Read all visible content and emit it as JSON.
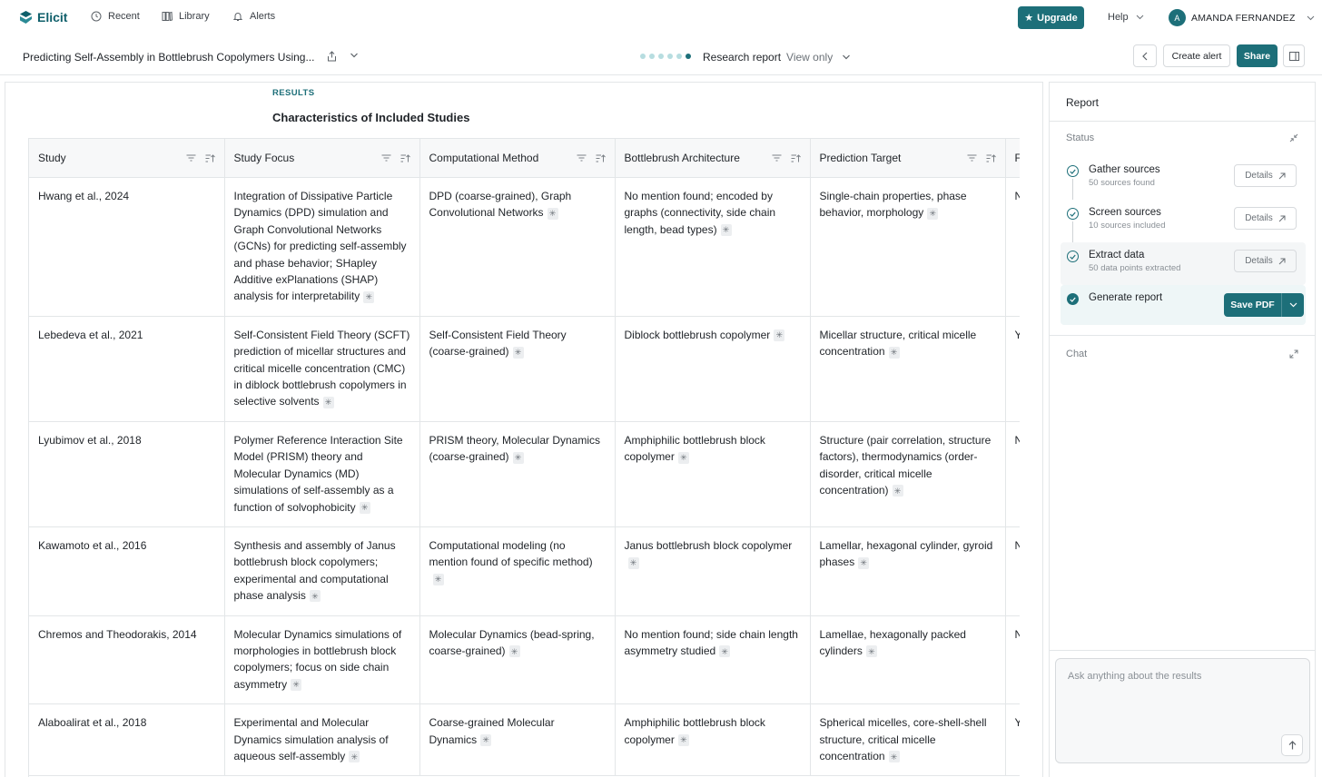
{
  "nav": {
    "brand": "Elicit",
    "recent": "Recent",
    "library": "Library",
    "alerts": "Alerts",
    "upgrade": "Upgrade",
    "help": "Help",
    "user_initial": "A",
    "user_name": "AMANDA FERNANDEZ"
  },
  "subbar": {
    "doc_title": "Predicting Self-Assembly in Bottlebrush Copolymers Using...",
    "report_type": "Research report",
    "access": "View only",
    "create_alert": "Create alert",
    "share": "Share",
    "progress_steps": 6,
    "progress_active": 6
  },
  "main": {
    "section_label": "RESULTS",
    "section_title": "Characteristics of Included Studies",
    "columns": [
      "Study",
      "Study Focus",
      "Computational Method",
      "Bottlebrush Architecture",
      "Prediction Target",
      "F"
    ],
    "rows": [
      {
        "study": "Hwang et al., 2024",
        "focus": "Integration of Dissipative Particle Dynamics (DPD) simulation and Graph Convolutional Networks (GCNs) for predicting self-assembly and phase behavior; SHapley Additive exPlanations (SHAP) analysis for interpretability",
        "method": "DPD (coarse-grained), Graph Convolutional Networks",
        "architecture": "No mention found; encoded by graphs (connectivity, side chain length, bead types)",
        "target": "Single-chain properties, phase behavior, morphology",
        "extra": "N"
      },
      {
        "study": "Lebedeva et al., 2021",
        "focus": "Self-Consistent Field Theory (SCFT) prediction of micellar structures and critical micelle concentration (CMC) in diblock bottlebrush copolymers in selective solvents",
        "method": "Self-Consistent Field Theory (coarse-grained)",
        "architecture": "Diblock bottlebrush copolymer",
        "target": "Micellar structure, critical micelle concentration",
        "extra": "Y"
      },
      {
        "study": "Lyubimov et al., 2018",
        "focus": "Polymer Reference Interaction Site Model (PRISM) theory and Molecular Dynamics (MD) simulations of self-assembly as a function of solvophobicity",
        "method": "PRISM theory, Molecular Dynamics (coarse-grained)",
        "architecture": "Amphiphilic bottlebrush block copolymer",
        "target": "Structure (pair correlation, structure factors), thermodynamics (order-disorder, critical micelle concentration)",
        "extra": "N"
      },
      {
        "study": "Kawamoto et al., 2016",
        "focus": "Synthesis and assembly of Janus bottlebrush block copolymers; experimental and computational phase analysis",
        "method": "Computational modeling (no mention found of specific method)",
        "architecture": "Janus bottlebrush block copolymer",
        "target": "Lamellar, hexagonal cylinder, gyroid phases",
        "extra": "N"
      },
      {
        "study": "Chremos and Theodorakis, 2014",
        "focus": "Molecular Dynamics simulations of morphologies in bottlebrush block copolymers; focus on side chain asymmetry",
        "method": "Molecular Dynamics (bead-spring, coarse-grained)",
        "architecture": "No mention found; side chain length asymmetry studied",
        "target": "Lamellae, hexagonally packed cylinders",
        "extra": "N"
      },
      {
        "study": "Alaboalirat et al., 2018",
        "focus": "Experimental and Molecular Dynamics simulation analysis of aqueous self-assembly",
        "method": "Coarse-grained Molecular Dynamics",
        "architecture": "Amphiphilic bottlebrush block copolymer",
        "target": "Spherical micelles, core-shell-shell structure, critical micelle concentration",
        "extra": "Y"
      }
    ]
  },
  "side": {
    "header": "Report",
    "status_label": "Status",
    "steps": [
      {
        "title": "Gather sources",
        "sub": "50 sources found",
        "action": "Details"
      },
      {
        "title": "Screen sources",
        "sub": "10 sources included",
        "action": "Details"
      },
      {
        "title": "Extract data",
        "sub": "50 data points extracted",
        "action": "Details"
      },
      {
        "title": "Generate report",
        "sub": "",
        "action": "Save PDF"
      }
    ],
    "chat_label": "Chat",
    "chat_placeholder": "Ask anything about the results"
  },
  "colors": {
    "accent": "#1d6f79",
    "border": "#e3e6e8",
    "muted_text": "#7b8187"
  }
}
